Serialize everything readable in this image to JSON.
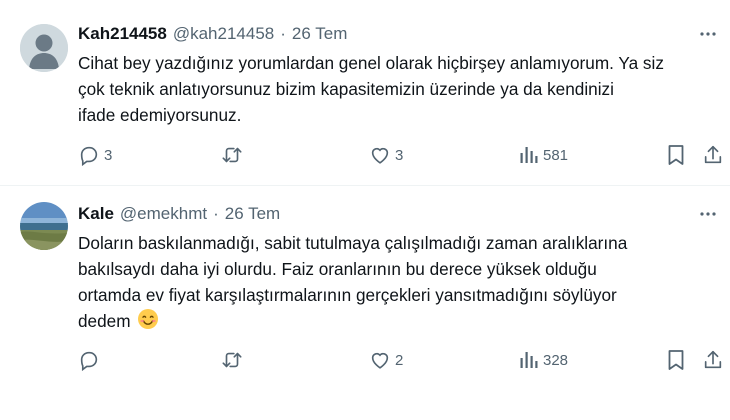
{
  "tweets": [
    {
      "name": "Kah214458",
      "handle": "@kah214458",
      "separator": "·",
      "date": "26 Tem",
      "text_lines": [
        "Cihat bey yazdığınız yorumlardan genel olarak hiçbirşey anlamıyorum. Ya siz",
        "çok teknik anlatıyorsunuz bizim kapasitemizin üzerinde ya da kendinizi",
        "ifade edemiyorsunuz."
      ],
      "emoji": "",
      "replies": "3",
      "retweets": "",
      "likes": "3",
      "views": "581"
    },
    {
      "name": "Kale",
      "handle": "@emekhmt",
      "separator": "·",
      "date": "26 Tem",
      "text_lines": [
        "Doların baskılanmadığı, sabit tutulmaya çalışılmadığı zaman aralıklarına",
        "bakılsaydı daha iyi olurdu. Faiz oranlarının bu derece yüksek olduğu",
        "ortamda ev fiyat karşılaştırmalarının gerçekleri yansıtmadığını söylüyor",
        "dedem"
      ],
      "emoji": "smiling-face-emoji",
      "replies": "",
      "retweets": "",
      "likes": "2",
      "views": "328"
    }
  ],
  "icons": [
    "more-icon",
    "reply-icon",
    "retweet-icon",
    "like-icon",
    "views-icon",
    "bookmark-icon",
    "share-icon"
  ],
  "colors": {
    "text": "#0f1419",
    "secondary": "#536471",
    "divider": "#eff3f4"
  }
}
